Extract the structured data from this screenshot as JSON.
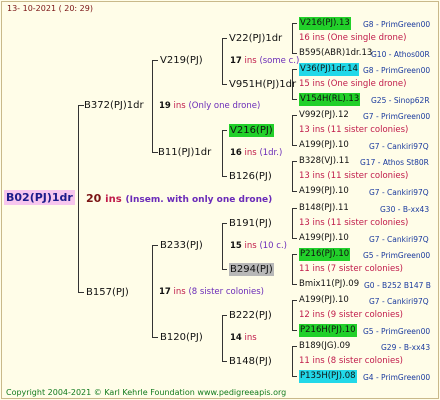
{
  "date": "13- 10-2021 ( 20: 29)",
  "footer": "Copyright 2004-2021 © Karl Kehrle Foundation    www.pedigreeapis.org",
  "colors": {
    "green": "#22d02a",
    "cyan": "#22d8e8",
    "gray": "#b8b8b8",
    "root_bg": "#f7c6ee"
  },
  "root": {
    "name": "B02(PJ)1dr",
    "count": "20",
    "ins": "ins",
    "note": "(Insem. with only one drone)"
  },
  "gen1": [
    {
      "name": "B372(PJ)1dr",
      "count": "19",
      "ins": "ins",
      "note": "(Only one drone)"
    },
    {
      "name": "B157(PJ)",
      "count": "17",
      "ins": "ins",
      "note": "(8 sister colonies)"
    }
  ],
  "gen2": [
    {
      "name": "V219(PJ)",
      "count": "17",
      "ins": "ins",
      "note": "(some c.)"
    },
    {
      "name": "B11(PJ)1dr",
      "count": "16",
      "ins": "ins",
      "note": "(1dr.)"
    },
    {
      "name": "B233(PJ)",
      "count": "15",
      "ins": "ins",
      "note": "(10 c.)"
    },
    {
      "name": "B120(PJ)",
      "count": "14",
      "ins": "ins",
      "note": ""
    }
  ],
  "gen3": [
    {
      "name": "V22(PJ)1dr",
      "count": "",
      "ins": "",
      "note": ""
    },
    {
      "name": "V951H(PJ)1dr",
      "count": "",
      "ins": "",
      "note": ""
    },
    {
      "name": "V216(PJ)",
      "count": "",
      "ins": "",
      "note": ""
    },
    {
      "name": "B126(PJ)",
      "count": "",
      "ins": "",
      "note": ""
    },
    {
      "name": "B191(PJ)",
      "count": "",
      "ins": "",
      "note": ""
    },
    {
      "name": "B294(PJ)",
      "count": "",
      "ins": "",
      "note": ""
    },
    {
      "name": "B222(PJ)",
      "count": "",
      "ins": "",
      "note": ""
    },
    {
      "name": "B148(PJ)",
      "count": "",
      "ins": "",
      "note": ""
    }
  ],
  "gen4": [
    {
      "top": "V216(PJ).13",
      "top_ref": "G8 - PrimGreen00",
      "mid": "16 ins (One single drone)",
      "bot": "B595(ABR)1dr.13",
      "bot_ref": "G10 - Athos00R"
    },
    {
      "top": "V36(PJ)1dr.14",
      "top_ref": "G8 - PrimGreen00",
      "mid": "15 ins (One single drone)",
      "bot": "V154H(RL).13",
      "bot_ref": "G25 - Sinop62R"
    },
    {
      "top": "V992(PJ).12",
      "top_ref": "G7 - PrimGreen00",
      "mid": "13 ins (11 sister colonies)",
      "bot": "A199(PJ).10",
      "bot_ref": "G7 - Cankiri97Q"
    },
    {
      "top": "B328(VJ).11",
      "top_ref": "G17 - Athos St80R",
      "mid": "13 ins (11 sister colonies)",
      "bot": "A199(PJ).10",
      "bot_ref": "G7 - Cankiri97Q"
    },
    {
      "top": "B148(PJ).11",
      "top_ref": "G30 - B-xx43",
      "mid": "13 ins (11 sister colonies)",
      "bot": "A199(PJ).10",
      "bot_ref": "G7 - Cankiri97Q"
    },
    {
      "top": "P216(PJ).10",
      "top_ref": "G5 - PrimGreen00",
      "mid": "11 ins (7 sister colonies)",
      "bot": "Bmix11(PJ).09",
      "bot_ref": "G0 - B252 B147 B"
    },
    {
      "top": "A199(PJ).10",
      "top_ref": "G7 - Cankiri97Q",
      "mid": "12 ins (9 sister colonies)",
      "bot": "P216H(PJ).10",
      "bot_ref": "G5 - PrimGreen00"
    },
    {
      "top": "B189(JG).09",
      "top_ref": "G29 - B-xx43",
      "mid": "11 ins (8 sister colonies)",
      "bot": "P135H(PJ).08",
      "bot_ref": "G4 - PrimGreen00"
    }
  ]
}
